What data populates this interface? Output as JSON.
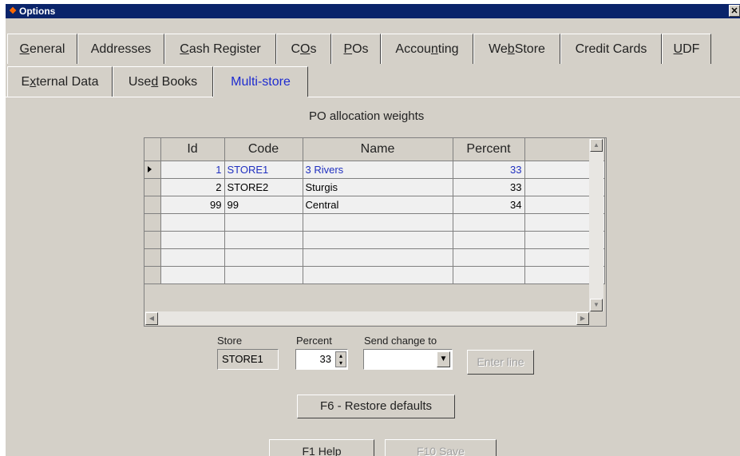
{
  "window": {
    "title": "Options",
    "close_glyph": "✕",
    "app_icon": "options-app-icon"
  },
  "tabs_row1": [
    {
      "label": "General",
      "key": "G",
      "rest": "eneral"
    },
    {
      "label": "Addresses"
    },
    {
      "label": "Cash Register",
      "key": "C",
      "rest": "ash Register"
    },
    {
      "label": "COs",
      "pre": "C",
      "key": "O",
      "rest": "s"
    },
    {
      "label": "POs",
      "key": "P",
      "rest": "Os"
    },
    {
      "label": "Accounting",
      "pre": "Accou",
      "key": "n",
      "rest": "ting"
    },
    {
      "label": "WebStore",
      "pre": "We",
      "key": "b",
      "rest": "Store"
    },
    {
      "label": "Credit Cards"
    },
    {
      "label": "UDF",
      "key": "U",
      "rest": "DF"
    }
  ],
  "tabs_row2": [
    {
      "label": "External Data",
      "pre": "E",
      "key": "x",
      "rest": "ternal Data"
    },
    {
      "label": "Used Books",
      "pre": "Use",
      "key": "d",
      "rest": " Books"
    },
    {
      "label": "Multi-store",
      "active": true
    }
  ],
  "page": {
    "heading": "PO allocation weights"
  },
  "grid": {
    "columns": [
      "Id",
      "Code",
      "Name",
      "Percent"
    ],
    "rows": [
      {
        "id": "1",
        "code": "STORE1",
        "name": "3 Rivers",
        "percent": "33",
        "selected": true
      },
      {
        "id": "2",
        "code": "STORE2",
        "name": "Sturgis",
        "percent": "33"
      },
      {
        "id": "99",
        "code": "99",
        "name": "Central",
        "percent": "34"
      },
      {
        "id": "",
        "code": "",
        "name": "",
        "percent": ""
      },
      {
        "id": "",
        "code": "",
        "name": "",
        "percent": ""
      },
      {
        "id": "",
        "code": "",
        "name": "",
        "percent": ""
      },
      {
        "id": "",
        "code": "",
        "name": "",
        "percent": ""
      }
    ]
  },
  "editor": {
    "store_label": "Store",
    "store_value": "STORE1",
    "percent_label": "Percent",
    "percent_value": "33",
    "send_label": "Send change to",
    "send_value": "",
    "enter_line": "Enter line"
  },
  "buttons": {
    "restore": "F6 - Restore defaults",
    "help": "F1 Help",
    "save": "F10 Save"
  },
  "colors": {
    "title_bar": "#0a246a",
    "face": "#d4d0c8",
    "accent_text": "#1e2bd0"
  }
}
